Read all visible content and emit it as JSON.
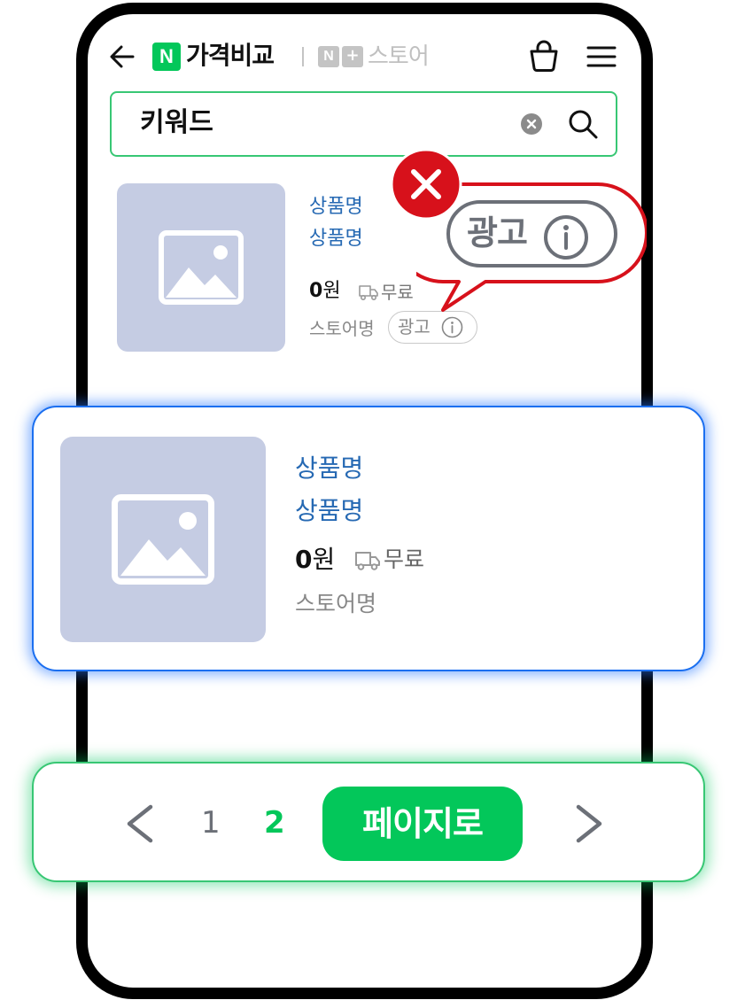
{
  "header": {
    "brand_badge": "N",
    "brand_title": "가격비교",
    "store_badge": "N",
    "store_plus": "+",
    "store_title": "스토어",
    "icons": [
      "back-arrow-icon",
      "cart-icon",
      "menu-icon"
    ]
  },
  "search": {
    "value": "키워드",
    "icons": [
      "clear-icon",
      "search-icon"
    ]
  },
  "product_ad": {
    "name_line1": "상품명",
    "name_line2": "상품명",
    "price_number": "0",
    "price_unit": "원",
    "shipping": "무료",
    "store": "스토어명",
    "ad_label": "광고"
  },
  "callout": {
    "ad_label": "광고",
    "marker": "x-mark",
    "color": "#d7111b"
  },
  "product_highlight": {
    "name_line1": "상품명",
    "name_line2": "상품명",
    "price_number": "0",
    "price_unit": "원",
    "shipping": "무료",
    "store": "스토어명"
  },
  "pagination": {
    "pages": [
      "1",
      "2"
    ],
    "current_page": "2",
    "go_label": "페이지로"
  },
  "colors": {
    "brand_green": "#03c75a",
    "link_blue": "#2669b3",
    "highlight_blue": "#1b6ff0",
    "thumb_bg": "#c5cce3"
  }
}
